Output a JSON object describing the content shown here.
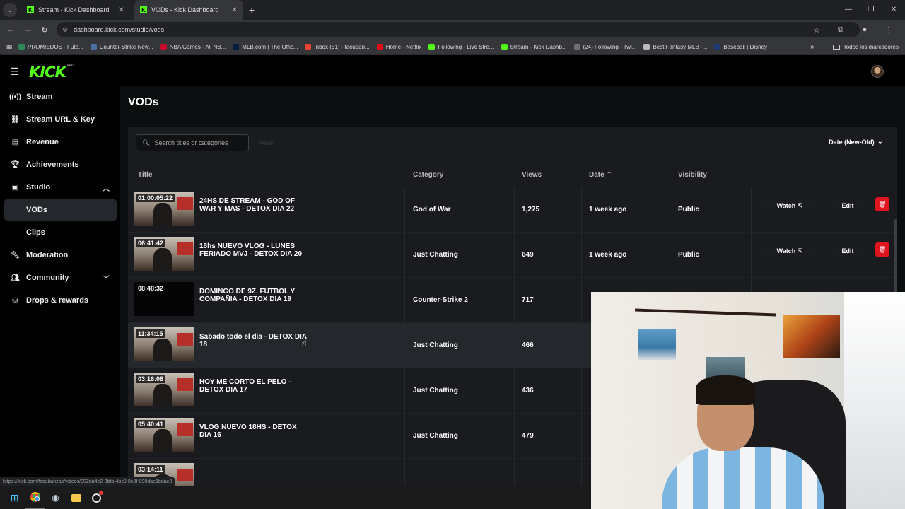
{
  "browser": {
    "tabs": [
      {
        "label": "Stream - Kick Dashboard",
        "active": false
      },
      {
        "label": "VODs - Kick Dashboard",
        "active": true
      }
    ],
    "url": "dashboard.kick.com/studio/vods",
    "bookmarks": [
      {
        "label": "PROMIEDOS - Futb...",
        "color": "#2e8b57"
      },
      {
        "label": "Counter-Strike New...",
        "color": "#4a6fa5"
      },
      {
        "label": "NBA Games - All NB...",
        "color": "#c9082a"
      },
      {
        "label": "MLB.com | The Offic...",
        "color": "#041e42"
      },
      {
        "label": "Inbox (51) - facuban...",
        "color": "#ea4335"
      },
      {
        "label": "Home - Netflix",
        "color": "#e50914"
      },
      {
        "label": "Following - Live Stre...",
        "color": "#53fc18"
      },
      {
        "label": "Stream - Kick Dashb...",
        "color": "#53fc18"
      },
      {
        "label": "(24) Following - Twi...",
        "color": "#6e6e6e"
      },
      {
        "label": "Best Fantasy MLB -...",
        "color": "#bbbbbb"
      },
      {
        "label": "Baseball | Disney+",
        "color": "#1f3b73"
      }
    ],
    "bookmarks_folder": "Todos los marcadores",
    "status_url": "https://kick.com/facubanzas/videos/002da4e2-8bfa-4bc9-8c8f-090dae1bdae3"
  },
  "app": {
    "logo": "KICK",
    "logo_badge": "BETA"
  },
  "sidebar": {
    "items": [
      {
        "label": "Stream",
        "icon": "broadcast-icon"
      },
      {
        "label": "Stream URL & Key",
        "icon": "link-icon"
      },
      {
        "label": "Revenue",
        "icon": "revenue-icon"
      },
      {
        "label": "Achievements",
        "icon": "trophy-icon"
      },
      {
        "label": "Studio",
        "icon": "studio-icon"
      },
      {
        "label": "VODs",
        "icon": ""
      },
      {
        "label": "Clips",
        "icon": ""
      },
      {
        "label": "Moderation",
        "icon": "wrench-icon"
      },
      {
        "label": "Community",
        "icon": "people-icon"
      },
      {
        "label": "Drops & rewards",
        "icon": "drops-icon"
      }
    ]
  },
  "main": {
    "title": "VODs",
    "search_placeholder": "Search titles or categories",
    "reset_label": "Reset",
    "sort_label": "Date (New-Old)",
    "columns": {
      "title": "Title",
      "category": "Category",
      "views": "Views",
      "date": "Date",
      "visibility": "Visibility"
    },
    "watch_label": "Watch",
    "edit_label": "Edit",
    "vods": [
      {
        "duration": "01:00:05:22",
        "title": "24HS DE STREAM - GOD OF WAR Y MAS - DETOX DIA 22",
        "category": "God of War",
        "views": "1,275",
        "date": "1 week ago",
        "visibility": "Public"
      },
      {
        "duration": "06:41:42",
        "title": "18hs NUEVO VLOG - LUNES FERIADO MVJ - DETOX DIA 20",
        "category": "Just Chatting",
        "views": "649",
        "date": "1 week ago",
        "visibility": "Public"
      },
      {
        "duration": "08:48:32",
        "title": "DOMINGO DE 9Z, FUTBOL Y COMPAÑIA - DETOX DIA 19",
        "category": "Counter-Strike 2",
        "views": "717",
        "date": "",
        "visibility": ""
      },
      {
        "duration": "11:34:15",
        "title": "Sabado todo el dia - DETOX DIA 18",
        "category": "Just Chatting",
        "views": "466",
        "date": "",
        "visibility": ""
      },
      {
        "duration": "03:16:08",
        "title": "HOY ME CORTO EL PELO - DETOX DIA 17",
        "category": "Just Chatting",
        "views": "436",
        "date": "",
        "visibility": ""
      },
      {
        "duration": "05:40:41",
        "title": "VLOG NUEVO 18HS - DETOX DIA 16",
        "category": "Just Chatting",
        "views": "479",
        "date": "",
        "visibility": ""
      },
      {
        "duration": "03:14:11",
        "title": "",
        "category": "",
        "views": "",
        "date": "",
        "visibility": ""
      }
    ]
  }
}
